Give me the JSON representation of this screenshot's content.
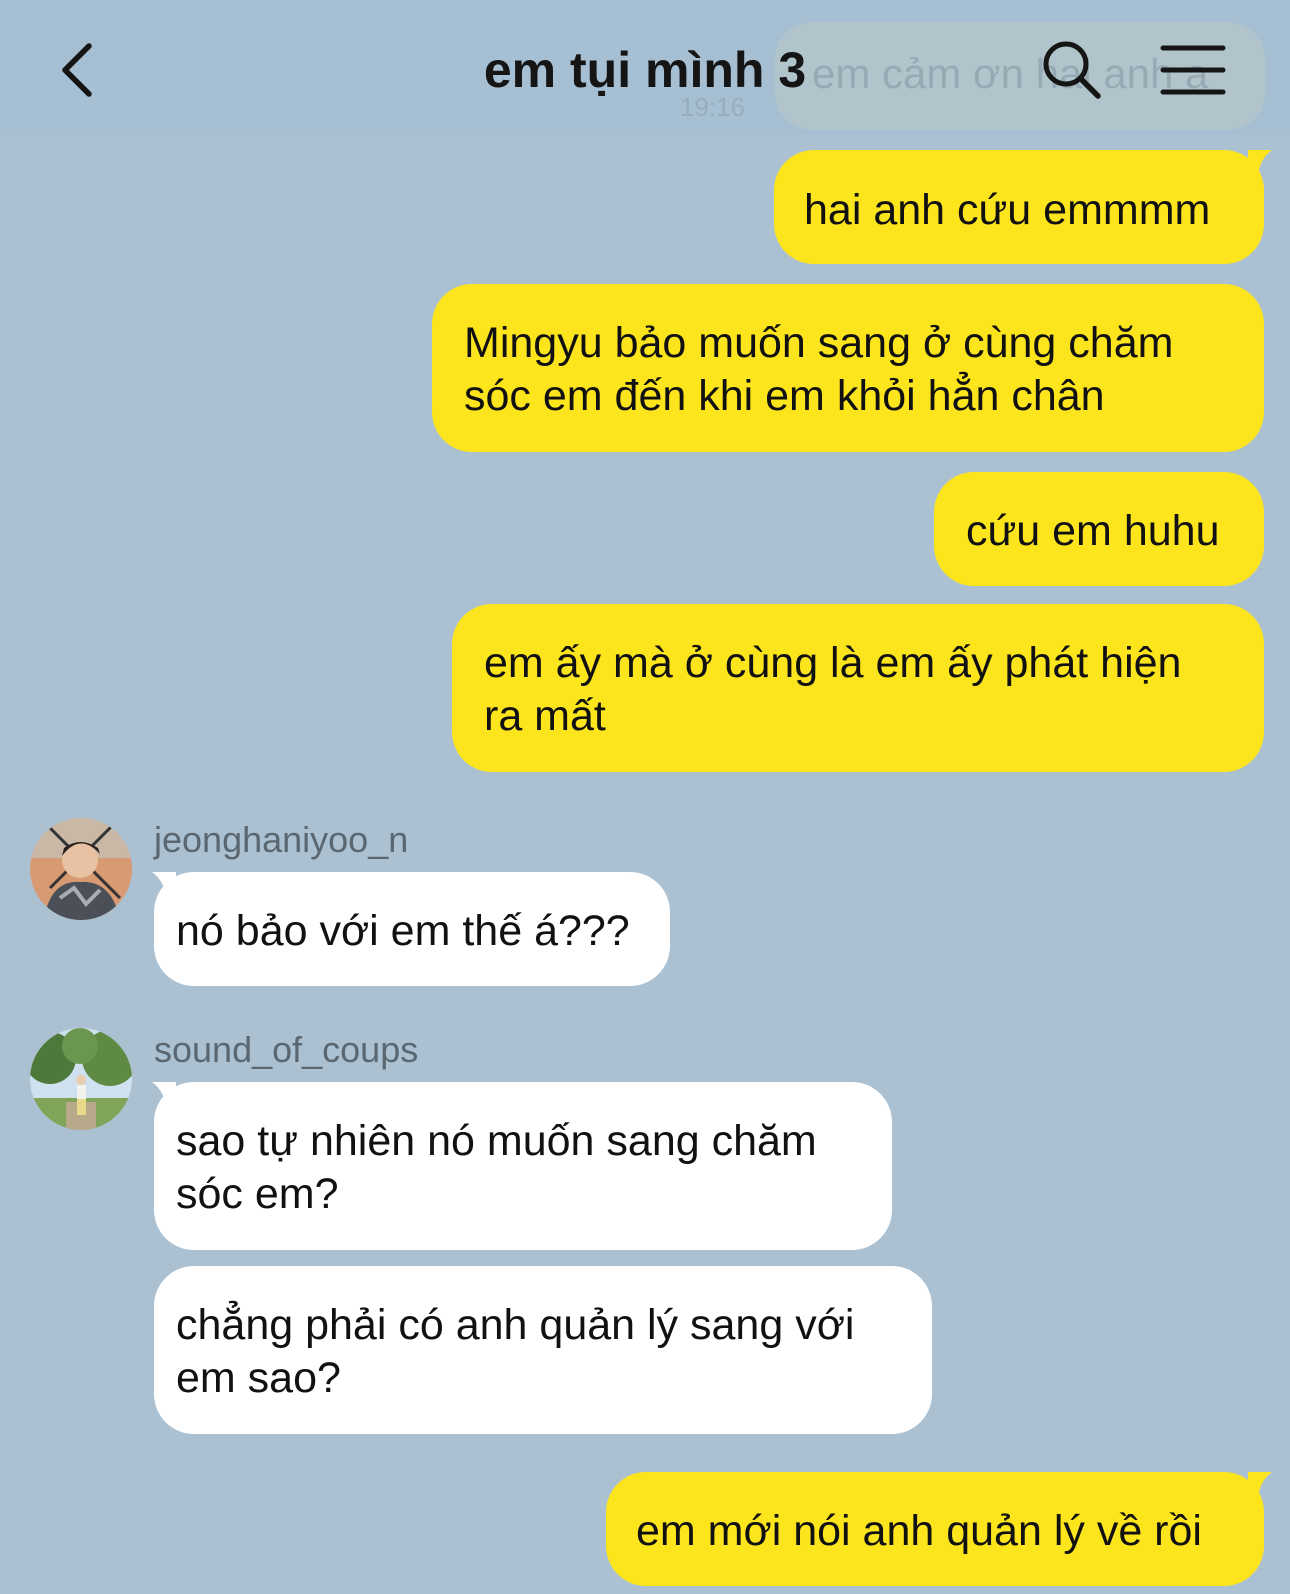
{
  "header": {
    "title": "em tụi mình 3",
    "ghost_preview": "em cảm ơn hai anh ạ",
    "ghost_time": "19:16"
  },
  "messages": [
    {
      "from": "me",
      "text": "hai anh cứu emmmm"
    },
    {
      "from": "me",
      "lines": [
        "Mingyu bảo muốn sang ở cùng chăm",
        "sóc em đến khi em khỏi hẳn chân"
      ]
    },
    {
      "from": "me",
      "text": "cứu em huhu"
    },
    {
      "from": "me",
      "lines": [
        "em ấy mà ở cùng là em ấy phát hiện",
        "ra mất"
      ]
    },
    {
      "from": "jeonghaniyoo_n",
      "text": "nó bảo với em thế á???"
    },
    {
      "from": "sound_of_coups",
      "lines": [
        "sao tự nhiên nó muốn sang chăm",
        "sóc em?"
      ]
    },
    {
      "from": "sound_of_coups",
      "lines": [
        "chẳng phải có anh quản lý sang với",
        "em sao?"
      ]
    },
    {
      "from": "me",
      "text": "em mới nói anh quản lý về rồi"
    }
  ],
  "senders": {
    "first": "jeonghaniyoo_n",
    "second": "sound_of_coups"
  },
  "colors": {
    "background": "#abc1d1",
    "my_bubble": "#fde51d",
    "their_bubble": "#ffffff"
  }
}
